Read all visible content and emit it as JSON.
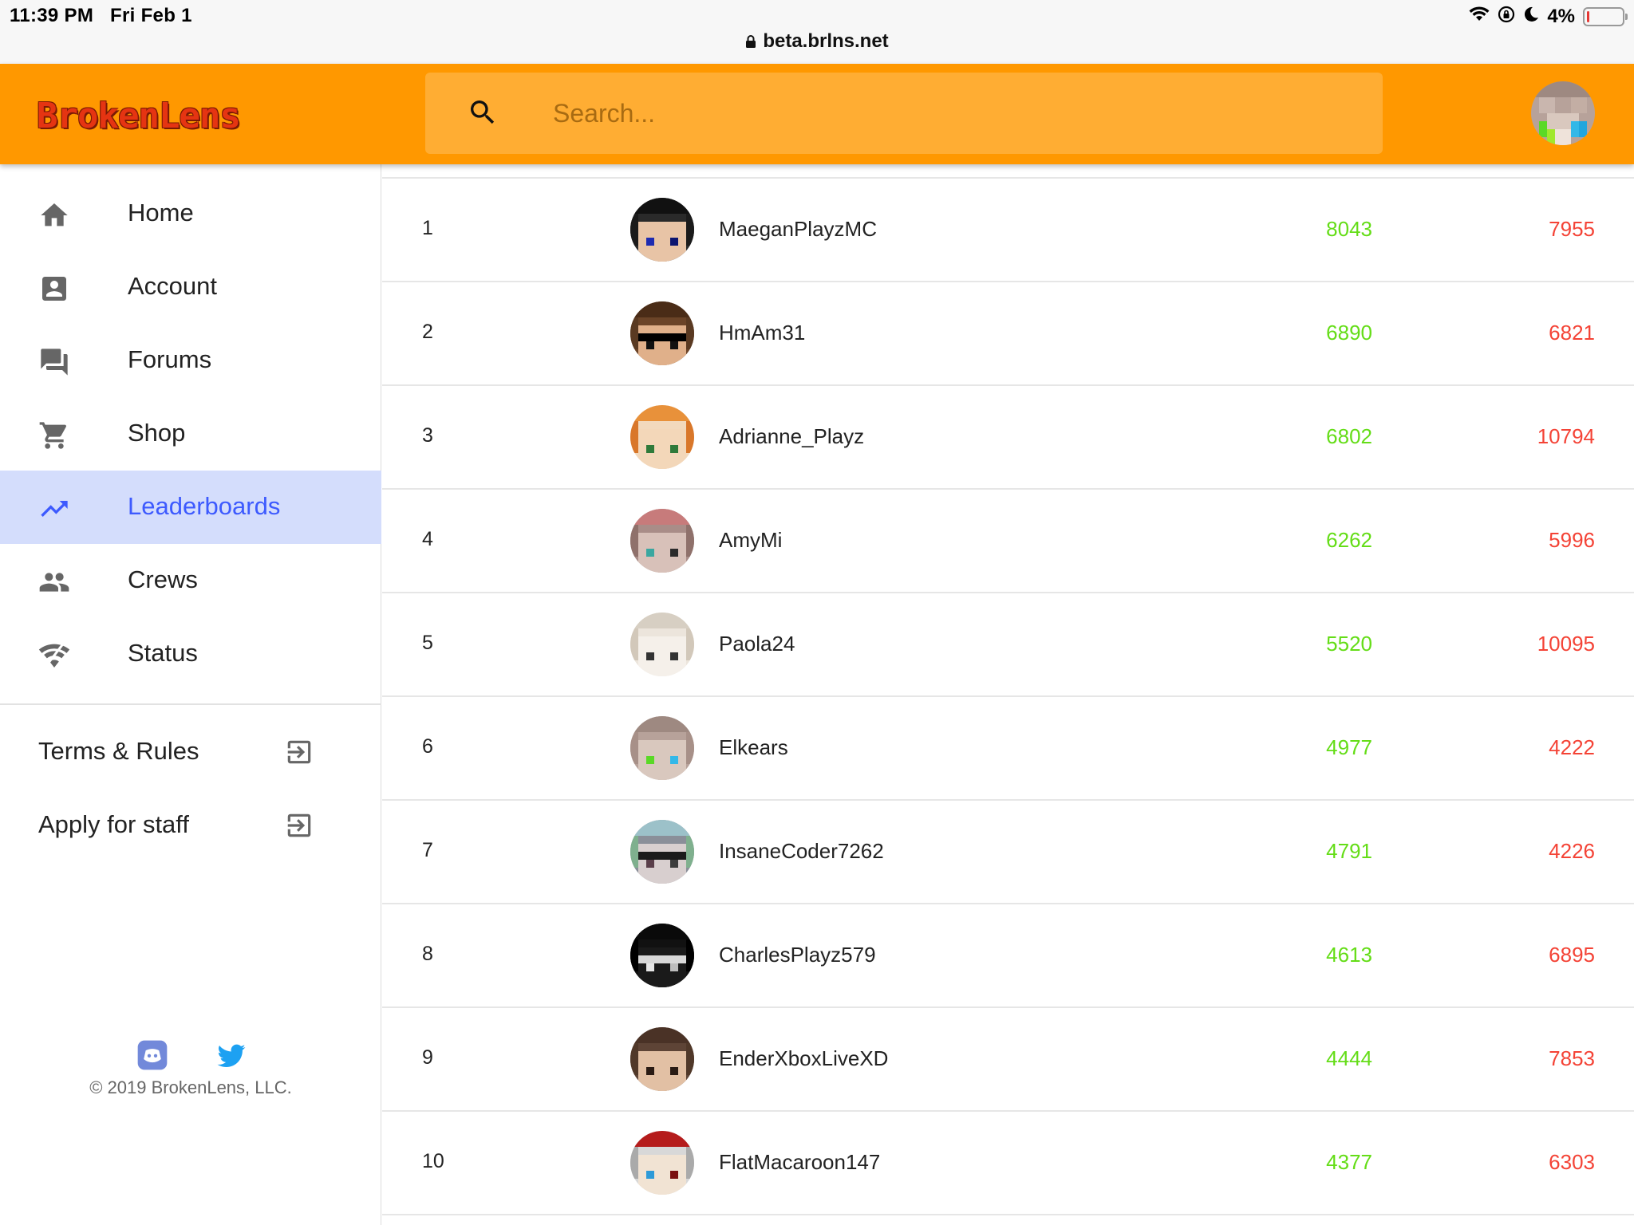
{
  "status_bar": {
    "time": "11:39 PM",
    "date": "Fri Feb 1",
    "battery": "4%",
    "battery_level": 0.04,
    "url": "beta.brlns.net",
    "icons": [
      "wifi-icon",
      "orientation-lock-icon",
      "do-not-disturb-icon",
      "battery-icon"
    ]
  },
  "header": {
    "logo": "BrokenLens",
    "search_placeholder": "Search...",
    "accent_color": "#ff9800"
  },
  "sidebar": {
    "nav": [
      {
        "label": "Home",
        "icon": "home-icon"
      },
      {
        "label": "Account",
        "icon": "account-box-icon"
      },
      {
        "label": "Forums",
        "icon": "forum-icon"
      },
      {
        "label": "Shop",
        "icon": "cart-icon"
      },
      {
        "label": "Leaderboards",
        "icon": "trending-up-icon",
        "active": true
      },
      {
        "label": "Crews",
        "icon": "people-icon"
      },
      {
        "label": "Status",
        "icon": "signal-icon"
      }
    ],
    "links": [
      {
        "label": "Terms & Rules",
        "icon": "exit-to-app-icon"
      },
      {
        "label": "Apply for staff",
        "icon": "exit-to-app-icon"
      }
    ],
    "social": [
      "discord-icon",
      "twitter-icon"
    ],
    "copyright": "© 2019 BrokenLens, LLC."
  },
  "leaderboard": {
    "colors": {
      "stat_a": "#64dd17",
      "stat_b": "#f44336",
      "active_nav": "#3d5afe"
    },
    "rows": [
      {
        "rank": "1",
        "name": "MaeganPlayzMC",
        "a": "8043",
        "b": "7955"
      },
      {
        "rank": "2",
        "name": "HmAm31",
        "a": "6890",
        "b": "6821"
      },
      {
        "rank": "3",
        "name": "Adrianne_Playz",
        "a": "6802",
        "b": "10794"
      },
      {
        "rank": "4",
        "name": "AmyMi",
        "a": "6262",
        "b": "5996"
      },
      {
        "rank": "5",
        "name": "Paola24",
        "a": "5520",
        "b": "10095"
      },
      {
        "rank": "6",
        "name": "Elkears",
        "a": "4977",
        "b": "4222"
      },
      {
        "rank": "7",
        "name": "InsaneCoder7262",
        "a": "4791",
        "b": "4226"
      },
      {
        "rank": "8",
        "name": "CharlesPlayz579",
        "a": "4613",
        "b": "6895"
      },
      {
        "rank": "9",
        "name": "EnderXboxLiveXD",
        "a": "4444",
        "b": "7853"
      },
      {
        "rank": "10",
        "name": "FlatMacaroon147",
        "a": "4377",
        "b": "6303"
      }
    ]
  }
}
